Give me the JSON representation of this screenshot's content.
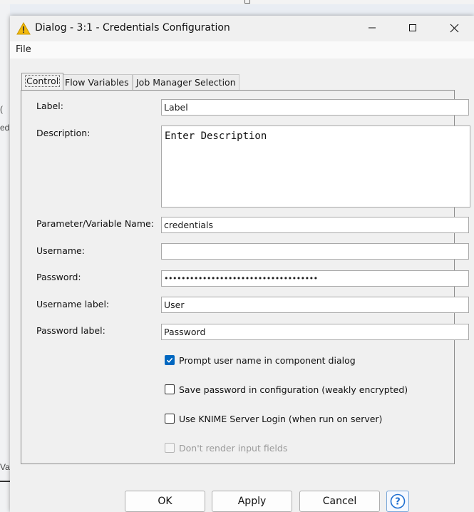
{
  "window": {
    "title": "Dialog - 3:1 - Credentials Configuration"
  },
  "icons": {
    "title": "warning-triangle-icon",
    "minimize": "minimize-icon",
    "maximize": "maximize-icon",
    "close": "close-icon",
    "help": "help-icon",
    "check": "check-icon"
  },
  "menu": {
    "file": "File"
  },
  "tabs": [
    {
      "label": "Control",
      "active": true
    },
    {
      "label": "Flow Variables",
      "active": false
    },
    {
      "label": "Job Manager Selection",
      "active": false
    }
  ],
  "form": {
    "label": {
      "label": "Label:",
      "value": "Label"
    },
    "description": {
      "label": "Description:",
      "value": "Enter Description"
    },
    "parameter": {
      "label": "Parameter/Variable Name:",
      "value": "credentials"
    },
    "username": {
      "label": "Username:",
      "value": ""
    },
    "password": {
      "label": "Password:",
      "value": "••••••••••••••••••••••••••••••••••••"
    },
    "username_label": {
      "label": "Username label:",
      "value": "User"
    },
    "password_label": {
      "label": "Password label:",
      "value": "Password"
    }
  },
  "checkboxes": {
    "prompt_username": {
      "label": "Prompt user name in component dialog",
      "checked": true
    },
    "save_password": {
      "label": "Save password in configuration (weakly encrypted)",
      "checked": false
    },
    "server_login": {
      "label": "Use KNIME Server Login (when run on server)",
      "checked": false
    },
    "dont_render": {
      "label": "Don't render input fields",
      "checked": false,
      "disabled": true
    }
  },
  "buttons": {
    "ok": "OK",
    "apply": "Apply",
    "cancel": "Cancel"
  },
  "background": {
    "left_glyph_1": "(",
    "left_glyph_2": "ed",
    "left_glyph_3": "Va"
  },
  "colors": {
    "accent": "#0067c0",
    "warning": "#f2b90b"
  }
}
